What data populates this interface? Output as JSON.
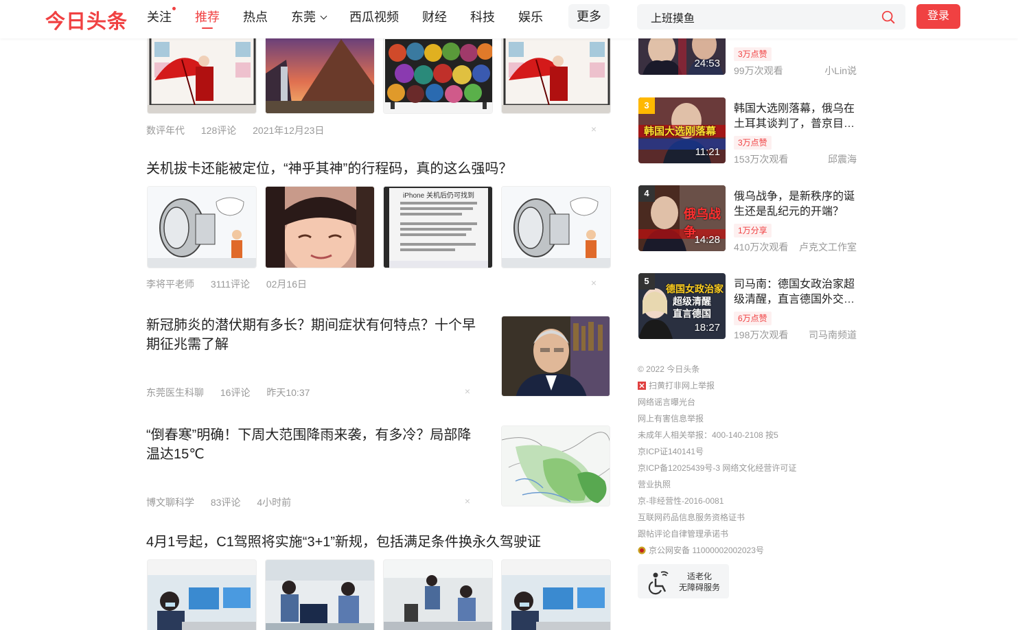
{
  "header": {
    "logo": "今日头条",
    "nav": [
      {
        "label": "关注"
      },
      {
        "label": "推荐"
      },
      {
        "label": "热点"
      },
      {
        "label": "东莞"
      },
      {
        "label": "西瓜视频"
      },
      {
        "label": "财经"
      },
      {
        "label": "科技"
      },
      {
        "label": "娱乐"
      }
    ],
    "more_label": "更多",
    "search_value": "上班摸鱼",
    "login_label": "登录"
  },
  "feed": [
    {
      "meta": [
        "数评年代",
        "128评论",
        "2021年12月23日"
      ],
      "close": "×"
    },
    {
      "title": "关机拔卡还能被定位，“神乎其神”的行程码，真的这么强吗？",
      "meta": [
        "李将平老师",
        "3111评论",
        "02月16日"
      ],
      "close": "×",
      "doc_text": [
        "iPhone 关机后仍可找到"
      ]
    },
    {
      "title": "新冠肺炎的潜伏期有多长？期间症状有何特点？十个早期征兆需了解",
      "meta": [
        "东莞医生科聊",
        "16评论",
        "昨天10:37"
      ],
      "close": "×"
    },
    {
      "title": "“倒春寒”明确！下周大范围降雨来袭，有多冷？局部降温达15℃",
      "meta": [
        "博文聊科学",
        "83评论",
        "4小时前"
      ],
      "close": "×"
    },
    {
      "title": "4月1号起，C1驾照将实施“3+1”新规，包括满足条件换永久驾驶证"
    }
  ],
  "sidebar": {
    "videos": [
      {
        "title": "",
        "badge": "3万点赞",
        "views": "99万次观看",
        "author": "小Lin说",
        "duration": "24:53"
      },
      {
        "rank": "3",
        "title": "韩国大选刚落幕，俄乌在土耳其谈判了，普京目…",
        "badge": "3万点赞",
        "views": "153万次观看",
        "author": "邱震海",
        "duration": "11:21",
        "overlay": "韩国大选刚落幕"
      },
      {
        "rank": "4",
        "title": "俄乌战争，是新秩序的诞生还是乱纪元的开端？",
        "badge": "1万分享",
        "views": "410万次观看",
        "author": "卢克文工作室",
        "duration": "14:28",
        "overlay": "俄乌战争"
      },
      {
        "rank": "5",
        "title": "司马南：德国女政治家超级清醒，直言德国外交…",
        "badge": "6万点赞",
        "views": "198万次观看",
        "author": "司马南频道",
        "duration": "18:27",
        "overlay1": "德国女政治家",
        "overlay2": "超级清醒",
        "overlay3": "直言德国"
      }
    ],
    "footer": [
      "© 2022 今日头条",
      "扫黄打非网上举报",
      "网络谣言曝光台",
      "网上有害信息举报",
      "未成年人相关举报：400-140-2108 按5",
      "京ICP证140141号",
      "京ICP备12025439号-3 网络文化经营许可证",
      "营业执照",
      "京-非经营性-2016-0081",
      "互联网药品信息服务资格证书",
      "跟帖评论自律管理承诺书",
      "京公网安备 11000002002023号"
    ],
    "a11y": {
      "line1": "适老化",
      "line2": "无障碍服务"
    }
  },
  "colors": {
    "brand": "#f04142",
    "muted": "#999999",
    "badge_bg": "#fdf0f0"
  }
}
